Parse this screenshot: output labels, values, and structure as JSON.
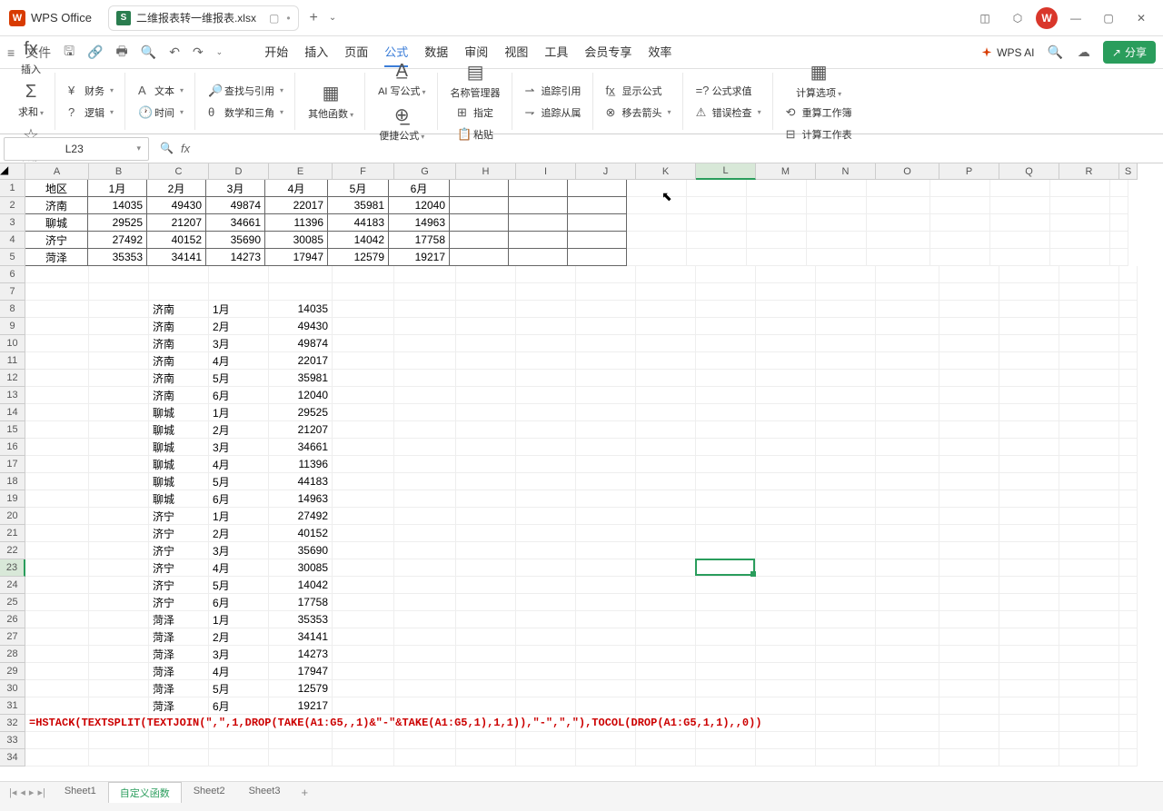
{
  "app": {
    "name": "WPS Office"
  },
  "tab": {
    "filename": "二维报表转一维报表.xlsx"
  },
  "quickbar": {
    "file": "文件"
  },
  "menu": {
    "tabs": [
      "开始",
      "插入",
      "页面",
      "公式",
      "数据",
      "审阅",
      "视图",
      "工具",
      "会员专享",
      "效率"
    ],
    "active_index": 3,
    "wps_ai": "WPS AI",
    "share": "分享"
  },
  "ribbon": {
    "insert": "插入",
    "sum": "求和",
    "common": "常用",
    "finance": "财务",
    "text": "文本",
    "lookup": "查找与引用",
    "logic": "逻辑",
    "time": "时间",
    "math": "数学和三角",
    "more": "其他函数",
    "ai_formula": "AI 写公式",
    "easy_formula": "便捷公式",
    "name_mgr": "名称管理器",
    "define": "指定",
    "paste": "粘贴",
    "trace_prec": "追踪引用",
    "trace_dep": "追踪从属",
    "show_formula": "显示公式",
    "move_arrow": "移去箭头",
    "eval": "公式求值",
    "error_check": "错误检查",
    "calc_opts": "计算选项",
    "recalc_book": "重算工作簿",
    "calc_sheet": "计算工作表"
  },
  "namebox": {
    "value": "L23"
  },
  "columns": [
    "A",
    "B",
    "C",
    "D",
    "E",
    "F",
    "G",
    "H",
    "I",
    "J",
    "K",
    "L",
    "M",
    "N",
    "O",
    "P",
    "Q",
    "R",
    "S"
  ],
  "col_widths": [
    "cw-A",
    "cw-B",
    "cw-C",
    "cw-D",
    "cw-E",
    "cw-F",
    "cw-G",
    "cw-H",
    "cw-I",
    "cw-J",
    "cw-K",
    "cw-L",
    "cw-M",
    "cw-N",
    "cw-O",
    "cw-P",
    "cw-Q",
    "cw-R",
    "cw-S"
  ],
  "selected_col": "L",
  "selected_row": 23,
  "table_header": [
    "地区",
    "1月",
    "2月",
    "3月",
    "4月",
    "5月",
    "6月"
  ],
  "table_rows": [
    [
      "济南",
      "14035",
      "49430",
      "49874",
      "22017",
      "35981",
      "12040"
    ],
    [
      "聊城",
      "29525",
      "21207",
      "34661",
      "11396",
      "44183",
      "14963"
    ],
    [
      "济宁",
      "27492",
      "40152",
      "35690",
      "30085",
      "14042",
      "17758"
    ],
    [
      "菏泽",
      "35353",
      "34141",
      "14273",
      "17947",
      "12579",
      "19217"
    ]
  ],
  "unpivot": [
    [
      "济南",
      "1月",
      "14035"
    ],
    [
      "济南",
      "2月",
      "49430"
    ],
    [
      "济南",
      "3月",
      "49874"
    ],
    [
      "济南",
      "4月",
      "22017"
    ],
    [
      "济南",
      "5月",
      "35981"
    ],
    [
      "济南",
      "6月",
      "12040"
    ],
    [
      "聊城",
      "1月",
      "29525"
    ],
    [
      "聊城",
      "2月",
      "21207"
    ],
    [
      "聊城",
      "3月",
      "34661"
    ],
    [
      "聊城",
      "4月",
      "11396"
    ],
    [
      "聊城",
      "5月",
      "44183"
    ],
    [
      "聊城",
      "6月",
      "14963"
    ],
    [
      "济宁",
      "1月",
      "27492"
    ],
    [
      "济宁",
      "2月",
      "40152"
    ],
    [
      "济宁",
      "3月",
      "35690"
    ],
    [
      "济宁",
      "4月",
      "30085"
    ],
    [
      "济宁",
      "5月",
      "14042"
    ],
    [
      "济宁",
      "6月",
      "17758"
    ],
    [
      "菏泽",
      "1月",
      "35353"
    ],
    [
      "菏泽",
      "2月",
      "34141"
    ],
    [
      "菏泽",
      "3月",
      "14273"
    ],
    [
      "菏泽",
      "4月",
      "17947"
    ],
    [
      "菏泽",
      "5月",
      "12579"
    ],
    [
      "菏泽",
      "6月",
      "19217"
    ]
  ],
  "formula_row32": "=HSTACK(TEXTSPLIT(TEXTJOIN(\",\",1,DROP(TAKE(A1:G5,,1)&\"-\"&TAKE(A1:G5,1),1,1)),\"-\",\",\"),TOCOL(DROP(A1:G5,1,1),,0))",
  "sheets": {
    "list": [
      "Sheet1",
      "自定义函数",
      "Sheet2",
      "Sheet3"
    ],
    "active_index": 1
  },
  "chart_data": null
}
